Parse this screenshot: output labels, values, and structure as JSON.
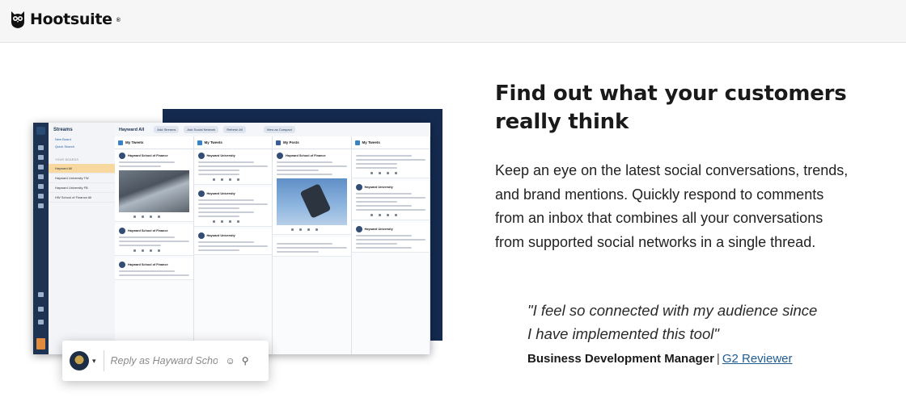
{
  "header": {
    "brand": "Hootsuite",
    "registered_mark": "®"
  },
  "app_preview": {
    "streams_title": "Streams",
    "links": [
      "New Board",
      "Quick Search"
    ],
    "section_label": "YOUR BOARDS",
    "boards": [
      "Hayward All",
      "Hayward University TW",
      "Hayward University FB",
      "HW School of Finance All"
    ],
    "board_title": "Hayward All",
    "board_buttons": [
      "Add Streams",
      "Add Social Network",
      "Refresh All",
      "View as Compact"
    ],
    "columns": [
      "My Tweets",
      "My Tweets",
      "My Posts",
      "My Tweets"
    ],
    "post_authors": [
      "Hayward School of Finance",
      "Hayward University",
      "Hayward School of Finance",
      "Hayward University"
    ]
  },
  "reply_box": {
    "placeholder": "Reply as Hayward Schoo..."
  },
  "content": {
    "headline": "Find out what your customers really think",
    "body": "Keep an eye on the latest social conversations, trends, and brand mentions. Quickly respond to comments from an inbox that combines all your conversations from supported social networks in a single thread.",
    "quote_line1": "\"I feel so connected with my audience since",
    "quote_line2": "I have implemented this tool\"",
    "attribution_role": "Business Development Manager",
    "attribution_separator": "|",
    "attribution_source": "G2 Reviewer"
  }
}
